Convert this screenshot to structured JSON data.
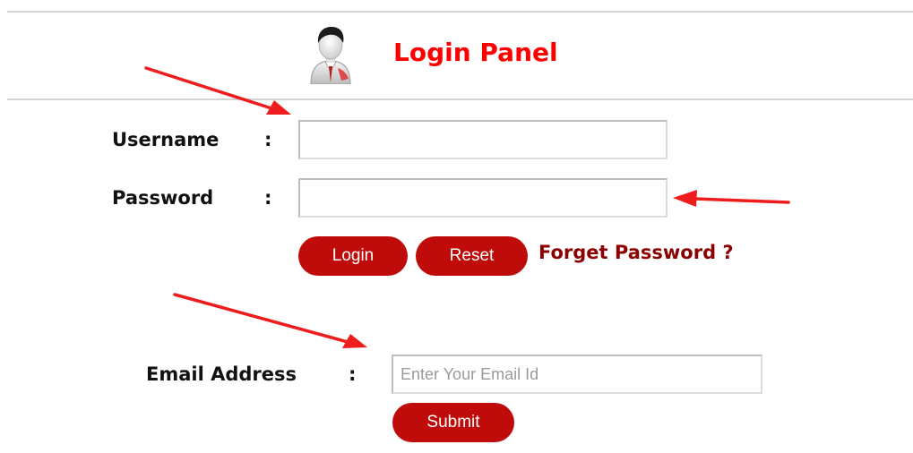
{
  "header": {
    "title": "Login Panel",
    "icon": "user-avatar-icon"
  },
  "login_form": {
    "username_label": "Username",
    "password_label": "Password",
    "colon": ":",
    "username_value": "",
    "password_value": "",
    "login_button": "Login",
    "reset_button": "Reset",
    "forget_link": "Forget Password ?"
  },
  "recovery_form": {
    "email_label": "Email Address",
    "colon": ":",
    "email_placeholder": "Enter Your Email Id",
    "email_value": "",
    "submit_button": "Submit"
  },
  "colors": {
    "title": "#ff0000",
    "button": "#c00b0b",
    "link": "#8b0000",
    "arrow": "#ee1c1c"
  }
}
